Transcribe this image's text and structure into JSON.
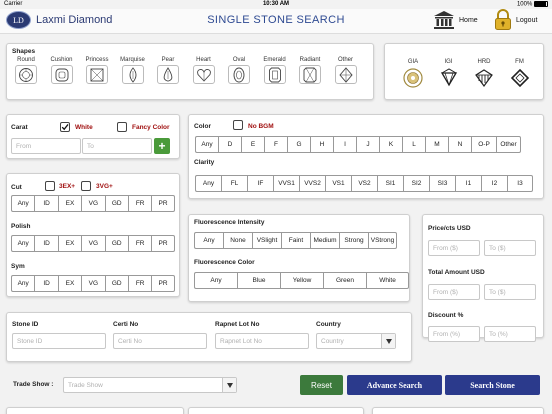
{
  "status": {
    "carrier": "Carrier",
    "time": "10:30 AM",
    "battery": "100%"
  },
  "header": {
    "logo_mark": "LD",
    "brand": "Laxmi Diamond",
    "title": "SINGLE STONE SEARCH",
    "home_label": "Home",
    "logout_label": "Logout"
  },
  "shapes": {
    "label": "Shapes",
    "items": [
      {
        "label": "Round",
        "icon": "round-icon"
      },
      {
        "label": "Cushion",
        "icon": "cushion-icon"
      },
      {
        "label": "Princess",
        "icon": "princess-icon"
      },
      {
        "label": "Marquise",
        "icon": "marquise-icon"
      },
      {
        "label": "Pear",
        "icon": "pear-icon"
      },
      {
        "label": "Heart",
        "icon": "heart-icon"
      },
      {
        "label": "Oval",
        "icon": "oval-icon"
      },
      {
        "label": "Emerald",
        "icon": "emerald-icon"
      },
      {
        "label": "Radiant",
        "icon": "radiant-icon"
      },
      {
        "label": "Other",
        "icon": "other-icon"
      }
    ]
  },
  "labs": {
    "items": [
      {
        "label": "GIA",
        "icon": "gia-logo-icon"
      },
      {
        "label": "IGI",
        "icon": "igi-logo-icon"
      },
      {
        "label": "HRD",
        "icon": "hrd-logo-icon"
      },
      {
        "label": "FM",
        "icon": "fm-logo-icon"
      }
    ]
  },
  "carat": {
    "label": "Carat",
    "white_label": "White",
    "white_checked": true,
    "fancy_label": "Fancy Color",
    "fancy_checked": false,
    "from_placeholder": "From",
    "to_placeholder": "To"
  },
  "color": {
    "label": "Color",
    "bgm_label": "No BGM",
    "options": [
      "Any",
      "D",
      "E",
      "F",
      "G",
      "H",
      "I",
      "J",
      "K",
      "L",
      "M",
      "N",
      "O-P",
      "Other"
    ]
  },
  "clarity": {
    "label": "Clarity",
    "options": [
      "Any",
      "FL",
      "IF",
      "VVS1",
      "VVS2",
      "VS1",
      "VS2",
      "SI1",
      "SI2",
      "SI3",
      "I1",
      "I2",
      "I3"
    ]
  },
  "cut": {
    "label": "Cut",
    "ex3_label": "3EX+",
    "vg3_label": "3VG+",
    "options": [
      "Any",
      "ID",
      "EX",
      "VG",
      "GD",
      "FR",
      "PR"
    ]
  },
  "polish": {
    "label": "Polish",
    "options": [
      "Any",
      "ID",
      "EX",
      "VG",
      "GD",
      "FR",
      "PR"
    ]
  },
  "sym": {
    "label": "Sym",
    "options": [
      "Any",
      "ID",
      "EX",
      "VG",
      "GD",
      "FR",
      "PR"
    ]
  },
  "fluor_intensity": {
    "label": "Fluorescence Intensity",
    "options": [
      "Any",
      "None",
      "VSlight",
      "Faint",
      "Medium",
      "Strong",
      "VStrong"
    ]
  },
  "fluor_color": {
    "label": "Fluorescence Color",
    "options": [
      "Any",
      "Blue",
      "Yellow",
      "Green",
      "White"
    ]
  },
  "price": {
    "label": "Price/cts USD",
    "from_placeholder": "From ($)",
    "to_placeholder": "To ($)"
  },
  "amount": {
    "label": "Total Amount USD",
    "from_placeholder": "From ($)",
    "to_placeholder": "To ($)"
  },
  "discount": {
    "label": "Discount %",
    "from_placeholder": "From (%)",
    "to_placeholder": "To (%)"
  },
  "ids": {
    "stone_label": "Stone ID",
    "stone_placeholder": "Stone ID",
    "certi_label": "Certi No",
    "certi_placeholder": "Certi No",
    "rapnet_label": "Rapnet Lot No",
    "rapnet_placeholder": "Rapnet Lot No",
    "country_label": "Country",
    "country_placeholder": "Country"
  },
  "tradeshow": {
    "label": "Trade Show :",
    "placeholder": "Trade Show"
  },
  "actions": {
    "reset": "Reset",
    "advance": "Advance Search",
    "search": "Search Stone"
  },
  "colors": {
    "accent": "#2b3a8c",
    "reset_green": "#3c7a3c",
    "checkbox_red": "#a01010"
  }
}
